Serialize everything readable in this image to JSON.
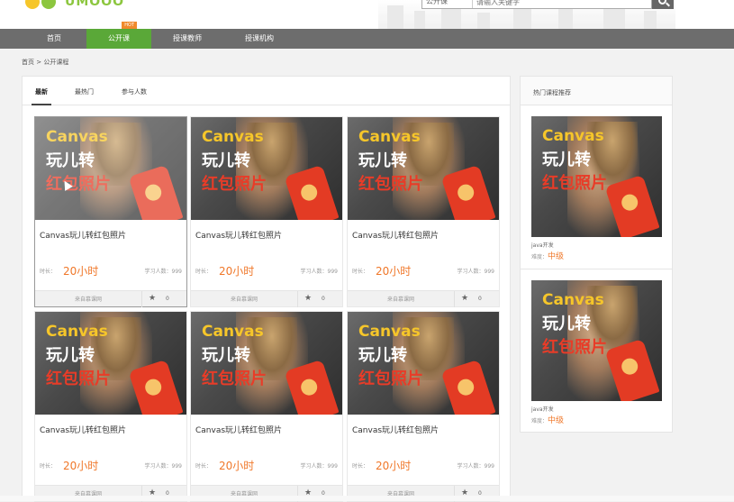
{
  "header": {
    "logo_text": "UMOOO",
    "search_scope": "公开课",
    "search_placeholder": "请输入关键字"
  },
  "nav": {
    "items": [
      "首页",
      "公开课",
      "授课教师",
      "授课机构"
    ],
    "active_index": 1,
    "hot_badge": "HOT"
  },
  "breadcrumb": "首页 > 公开课程",
  "tabs": [
    "最新",
    "最热门",
    "参与人数"
  ],
  "course_card": {
    "thumb_line1": "Canvas",
    "thumb_line2": "玩儿转",
    "thumb_line3": "红包照片",
    "title": "Canvas玩儿转红包照片",
    "duration_label": "时长：",
    "duration_value": "20小时",
    "students_label": "学习人数：999",
    "source": "来自慕课网",
    "fav_count": "0"
  },
  "sidebar": {
    "title": "热门课程推荐",
    "items": [
      {
        "category": "java开发",
        "level_label": "难度：",
        "level_value": "中级"
      },
      {
        "category": "java开发",
        "level_label": "难度：",
        "level_value": "中级"
      }
    ]
  },
  "colors": {
    "nav_bg": "#6d6d6d",
    "nav_active": "#5aa838",
    "accent_orange": "#f0782a",
    "hot_badge": "#f08a2c"
  }
}
